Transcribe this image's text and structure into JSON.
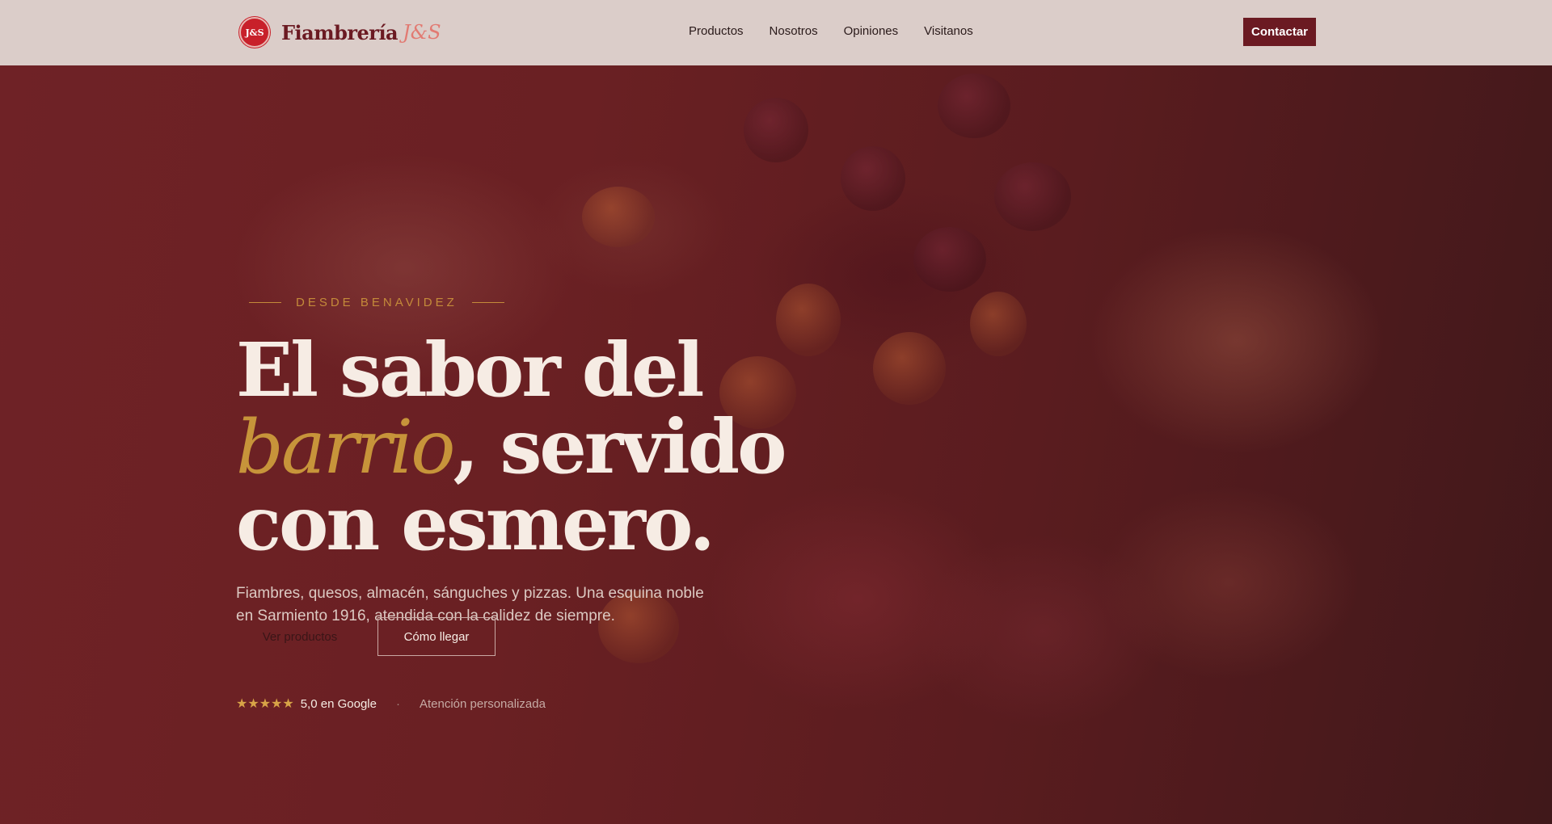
{
  "header": {
    "logo_text": "J&S",
    "brand_name": "Fiambrería",
    "brand_accent": "J&S",
    "nav": [
      "Productos",
      "Nosotros",
      "Opiniones",
      "Visitanos"
    ],
    "contact_label": "Contactar"
  },
  "hero": {
    "eyebrow": "DESDE BENAVIDEZ",
    "headline_line1": "El sabor del",
    "headline_accent": "barrio",
    "headline_line2_rest": ", servido",
    "headline_line3": "con esmero.",
    "subtitle": "Fiambres, quesos, almacén, sánguches y pizzas. Una esquina noble en Sarmiento 1916, atendida con la calidez de siempre.",
    "primary_button": "Ver productos",
    "secondary_button": "Cómo llegar",
    "stars": "★★★★★",
    "rating_text": "5,0 en Google",
    "separator": "·",
    "note": "Atención personalizada"
  },
  "colors": {
    "brand_red": "#6b1a22",
    "accent_gold": "#c7943a",
    "header_bg": "#dbcdc9",
    "logo_red": "#c8202a"
  }
}
